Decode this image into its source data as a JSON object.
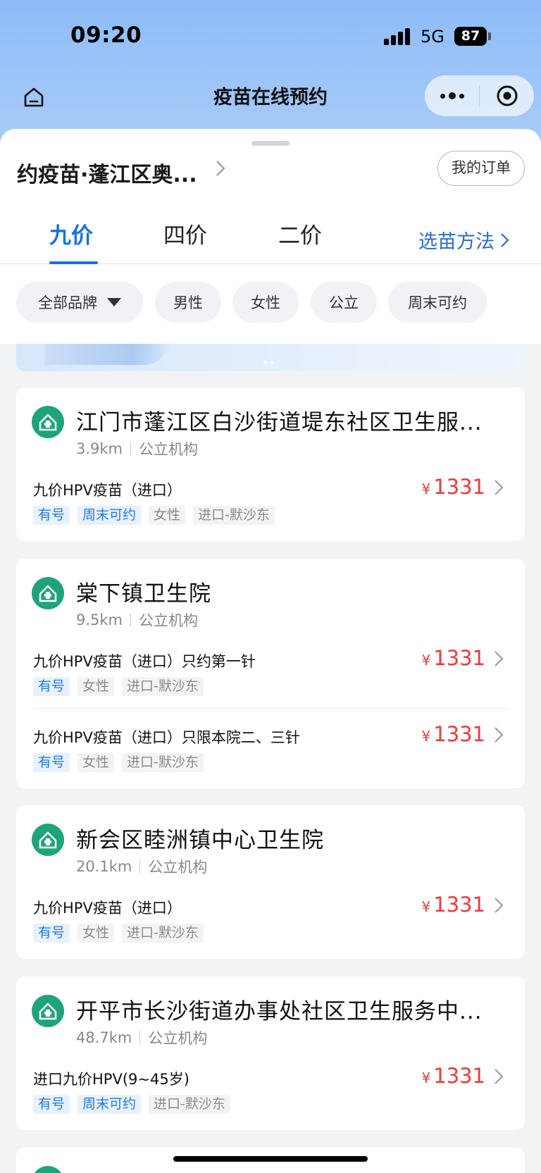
{
  "status_bar": {
    "time": "09:20",
    "network": "5G",
    "battery": "87"
  },
  "nav": {
    "title": "疫苗在线预约"
  },
  "header": {
    "location": "约疫苗·蓬江区奥...",
    "orders_button": "我的订单"
  },
  "tabs": [
    {
      "label": "九价",
      "active": true
    },
    {
      "label": "四价",
      "active": false
    },
    {
      "label": "二价",
      "active": false
    }
  ],
  "method_link": "选苗方法",
  "filters": [
    "全部品牌",
    "男性",
    "女性",
    "公立",
    "周末可约"
  ],
  "colors": {
    "accent": "#1672e8",
    "price": "#ee3a3a",
    "logo": "#1fa37a"
  },
  "institutions": [
    {
      "name": "江门市蓬江区白沙街道堤东社区卫生服...",
      "distance": "3.9km",
      "type": "公立机构",
      "offers": [
        {
          "name": "九价HPV疫苗（进口）",
          "currency": "¥",
          "price": "1331",
          "tags": [
            "有号",
            "周末可约",
            "女性",
            "进口-默沙东"
          ]
        }
      ]
    },
    {
      "name": "棠下镇卫生院",
      "distance": "9.5km",
      "type": "公立机构",
      "offers": [
        {
          "name": "九价HPV疫苗（进口）只约第一针",
          "currency": "¥",
          "price": "1331",
          "tags": [
            "有号",
            "女性",
            "进口-默沙东"
          ]
        },
        {
          "name": "九价HPV疫苗（进口）只限本院二、三针",
          "currency": "¥",
          "price": "1331",
          "tags": [
            "有号",
            "女性",
            "进口-默沙东"
          ]
        }
      ]
    },
    {
      "name": "新会区睦洲镇中心卫生院",
      "distance": "20.1km",
      "type": "公立机构",
      "offers": [
        {
          "name": "九价HPV疫苗（进口）",
          "currency": "¥",
          "price": "1331",
          "tags": [
            "有号",
            "女性",
            "进口-默沙东"
          ]
        }
      ]
    },
    {
      "name": "开平市长沙街道办事处社区卫生服务中...",
      "distance": "48.7km",
      "type": "公立机构",
      "offers": [
        {
          "name": "进口九价HPV(9~45岁)",
          "currency": "¥",
          "price": "1331",
          "tags": [
            "有号",
            "周末可约",
            "进口-默沙东"
          ]
        }
      ]
    }
  ]
}
